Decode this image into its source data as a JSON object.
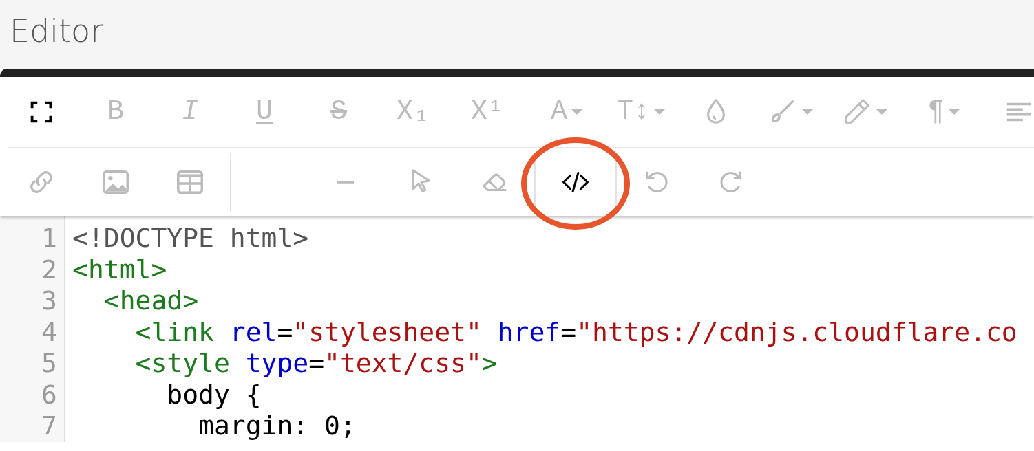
{
  "page_title": "Editor",
  "toolbar": {
    "rows": [
      {
        "groups": [
          {
            "buttons": [
              {
                "kind": "fullscreen",
                "disabled": false
              },
              {
                "kind": "bold",
                "glyph": "B",
                "disabled": true
              },
              {
                "kind": "italic",
                "glyph": "I",
                "disabled": true
              },
              {
                "kind": "underline",
                "glyph": "U",
                "disabled": true
              },
              {
                "kind": "strikethrough",
                "glyph": "S",
                "disabled": true
              },
              {
                "kind": "subscript",
                "glyph": "X₁",
                "disabled": true
              },
              {
                "kind": "superscript",
                "glyph": "X¹",
                "disabled": true
              }
            ]
          },
          {
            "buttons": [
              {
                "kind": "font_color",
                "glyph": "A",
                "dropdown": true,
                "disabled": true
              },
              {
                "kind": "font_size",
                "glyph": "T↕",
                "dropdown": true,
                "disabled": true
              },
              {
                "kind": "droplet",
                "disabled": true
              },
              {
                "kind": "brush",
                "dropdown": true,
                "disabled": true
              },
              {
                "kind": "pencil",
                "dropdown": true,
                "disabled": true
              }
            ]
          },
          {
            "buttons": [
              {
                "kind": "paragraph",
                "glyph": "¶",
                "dropdown": true,
                "disabled": true
              },
              {
                "kind": "align",
                "disabled": true
              }
            ]
          }
        ]
      },
      {
        "groups": [
          {
            "buttons": [
              {
                "kind": "link",
                "disabled": true
              },
              {
                "kind": "image",
                "disabled": true
              },
              {
                "kind": "table",
                "disabled": true
              }
            ]
          },
          {
            "buttons": [
              {
                "kind": "horizontal_line",
                "disabled": true
              },
              {
                "kind": "select",
                "disabled": true
              },
              {
                "kind": "eraser",
                "disabled": true
              }
            ]
          },
          {
            "buttons": [
              {
                "kind": "code_view",
                "disabled": false,
                "circled": true
              }
            ]
          },
          {
            "buttons": [
              {
                "kind": "undo",
                "disabled": true
              },
              {
                "kind": "redo",
                "disabled": true
              }
            ]
          }
        ]
      }
    ]
  },
  "code": {
    "lines": [
      {
        "number": "1",
        "tokens": [
          {
            "kind": "doctype",
            "text": "<!DOCTYPE html>"
          }
        ]
      },
      {
        "number": "2",
        "tokens": [
          {
            "kind": "tag",
            "text": "<html>"
          }
        ]
      },
      {
        "number": "3",
        "tokens": [
          {
            "kind": "tag",
            "text": "  <head>"
          }
        ]
      },
      {
        "number": "4",
        "tokens": [
          {
            "kind": "tag",
            "text": "    <link"
          },
          {
            "kind": "attribute",
            "text": " rel"
          },
          {
            "kind": "plain",
            "text": "="
          },
          {
            "kind": "string",
            "text": "\"stylesheet\""
          },
          {
            "kind": "attribute",
            "text": " href"
          },
          {
            "kind": "plain",
            "text": "="
          },
          {
            "kind": "string",
            "text": "\"https://cdnjs.cloudflare.co"
          }
        ]
      },
      {
        "number": "5",
        "tokens": [
          {
            "kind": "tag",
            "text": "    <style"
          },
          {
            "kind": "attribute",
            "text": " type"
          },
          {
            "kind": "plain",
            "text": "="
          },
          {
            "kind": "string",
            "text": "\"text/css\""
          },
          {
            "kind": "tag",
            "text": ">"
          }
        ]
      },
      {
        "number": "6",
        "tokens": [
          {
            "kind": "plain",
            "text": "      body {"
          }
        ]
      },
      {
        "number": "7",
        "tokens": [
          {
            "kind": "plain",
            "text": "        margin: 0;"
          }
        ]
      }
    ]
  }
}
